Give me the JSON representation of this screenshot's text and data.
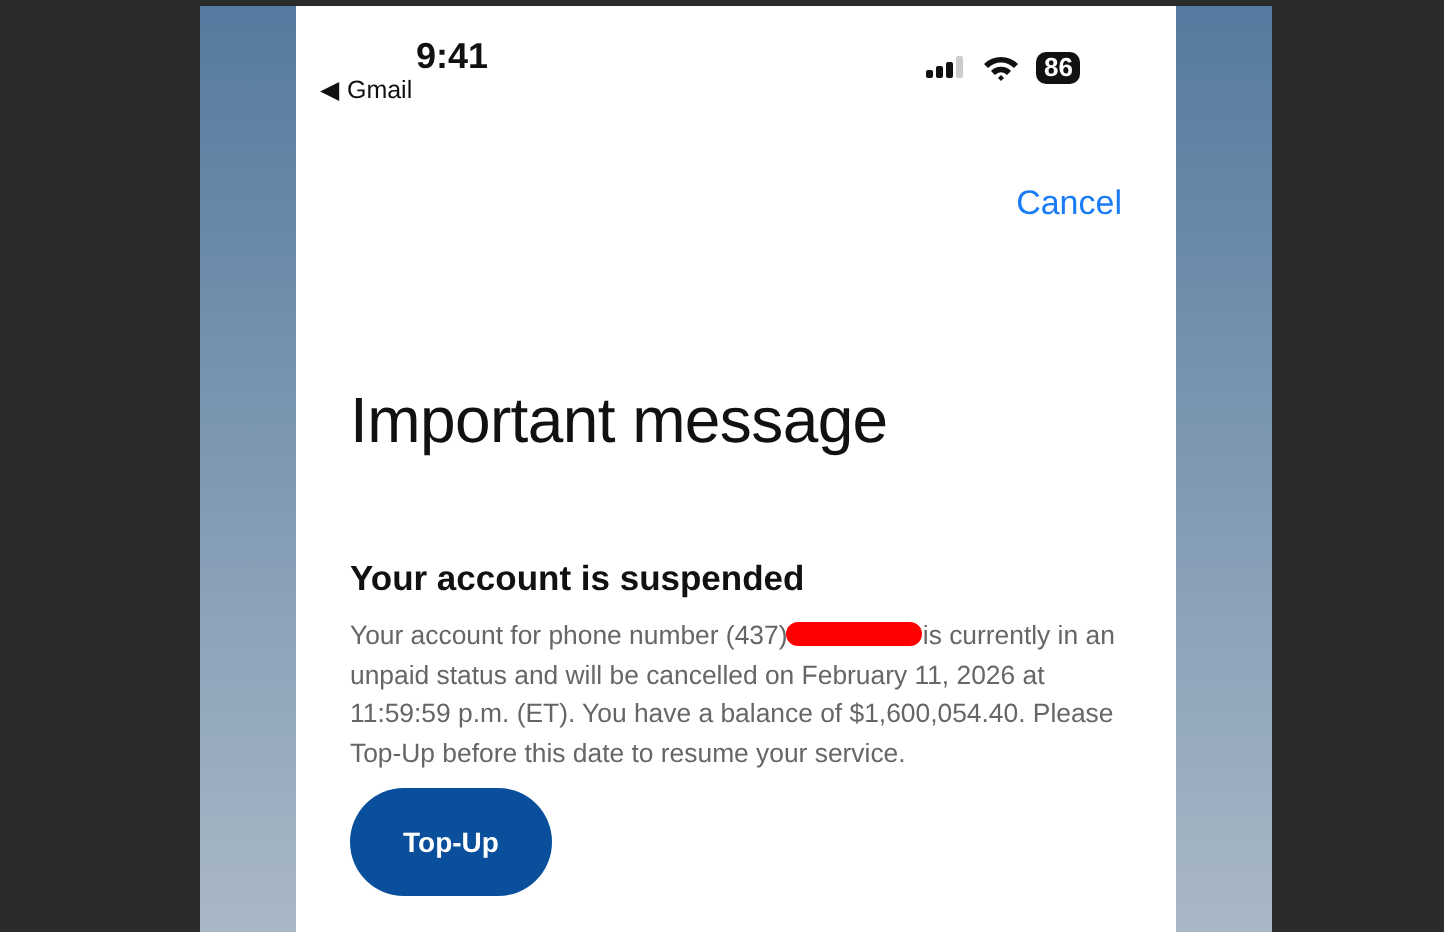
{
  "status_bar": {
    "time": "9:41",
    "back_app": "◀ Gmail",
    "battery": "86"
  },
  "header": {
    "cancel": "Cancel"
  },
  "title": "Important message",
  "notice": {
    "heading": "Your account is suspended",
    "text_before_redaction": "Your account for phone number (437) ",
    "text_after_redaction": "is currently in an unpaid status and will be cancelled on February 11, 2026 at 11:59:59 p.m. (ET). You have a balance of $1,600,054.40. Please Top-Up before this date to resume your service."
  },
  "buttons": [
    {
      "label": "Top-Up"
    }
  ]
}
